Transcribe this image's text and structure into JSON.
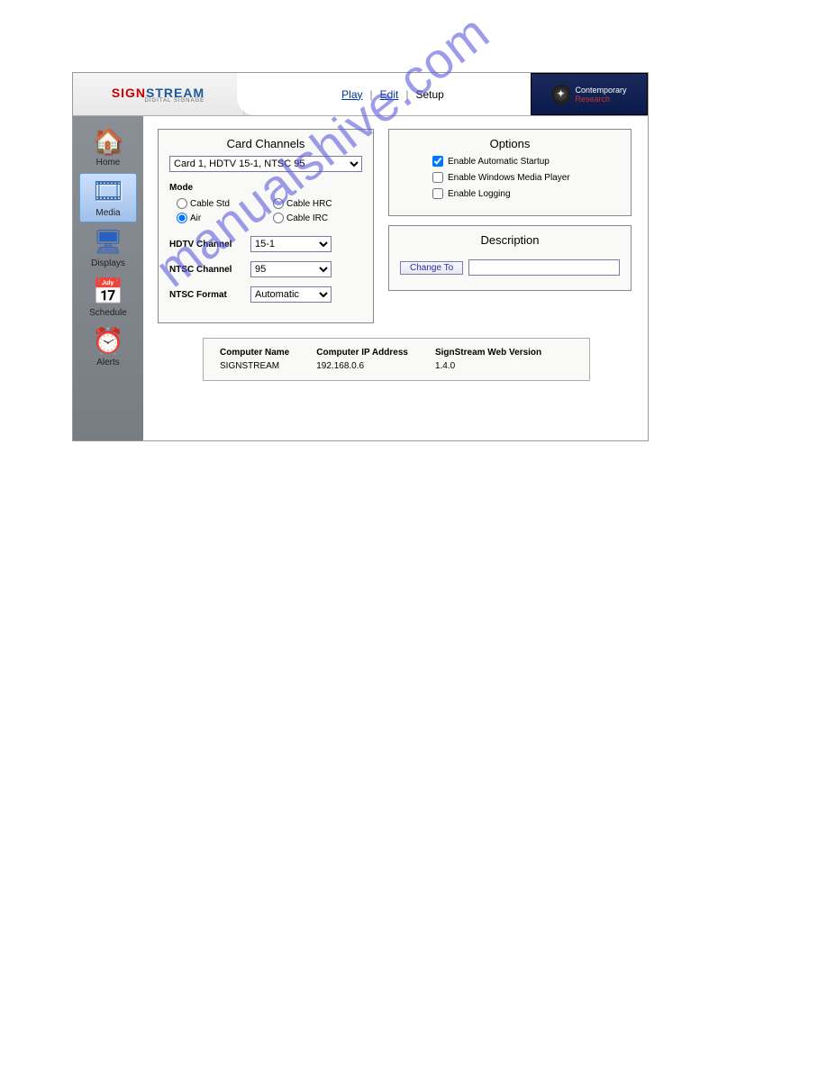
{
  "logo": {
    "line1a": "SIGN",
    "line1b": "STREAM",
    "sub": "DIGITAL SIGNAGE"
  },
  "topnav": {
    "play": "Play",
    "edit": "Edit",
    "setup": "Setup",
    "sep": "|"
  },
  "brand": {
    "l1": "Contemporary",
    "l2": "Research"
  },
  "sidebar": {
    "items": [
      {
        "label": "Home"
      },
      {
        "label": "Media"
      },
      {
        "label": "Displays"
      },
      {
        "label": "Schedule"
      },
      {
        "label": "Alerts"
      }
    ]
  },
  "card": {
    "title": "Card Channels",
    "selected": "Card 1, HDTV 15-1, NTSC 95",
    "mode_label": "Mode",
    "modes": {
      "cable_std": "Cable Std",
      "cable_hrc": "Cable HRC",
      "air": "Air",
      "cable_irc": "Cable IRC"
    },
    "hdtv_label": "HDTV Channel",
    "hdtv_value": "15-1",
    "ntsc_ch_label": "NTSC Channel",
    "ntsc_ch_value": "95",
    "ntsc_fmt_label": "NTSC Format",
    "ntsc_fmt_value": "Automatic"
  },
  "options": {
    "title": "Options",
    "auto": "Enable Automatic Startup",
    "wmp": "Enable Windows Media Player",
    "log": "Enable Logging"
  },
  "desc": {
    "title": "Description",
    "button": "Change To",
    "value": ""
  },
  "info": {
    "h1": "Computer Name",
    "v1": "SIGNSTREAM",
    "h2": "Computer IP Address",
    "v2": "192.168.0.6",
    "h3": "SignStream Web Version",
    "v3": "1.4.0"
  },
  "watermark": "manualshive.com"
}
